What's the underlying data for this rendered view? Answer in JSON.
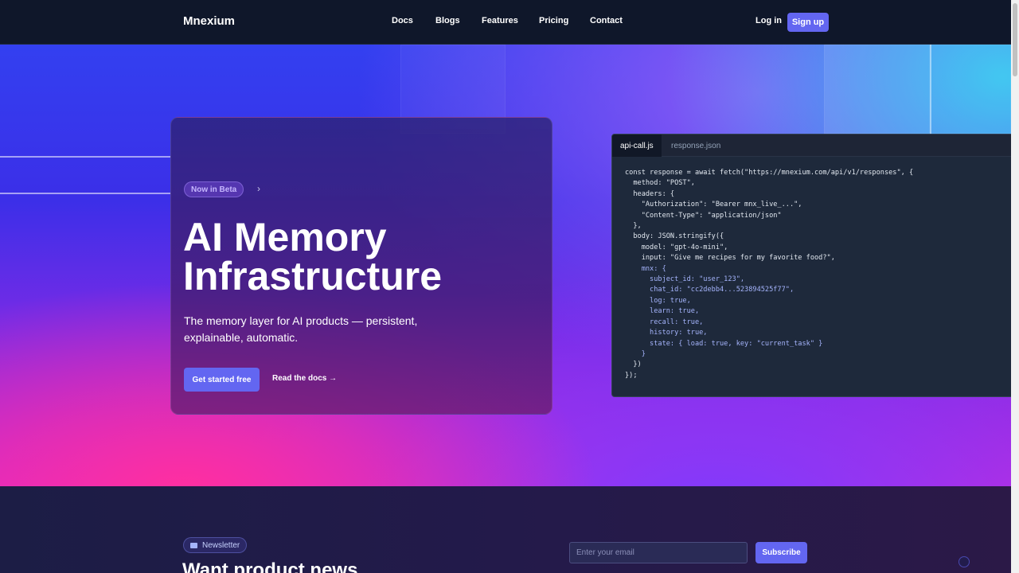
{
  "nav": {
    "brand": "Mnexium",
    "links": [
      "Docs",
      "Blogs",
      "Features",
      "Pricing",
      "Contact"
    ],
    "login": "Log in",
    "signup": "Sign up"
  },
  "hero": {
    "badge": "Now in Beta",
    "badge_arrow": "›",
    "title_line1": "AI Memory",
    "title_line2": "Infrastructure",
    "subtitle": "The memory layer for AI products — persistent, explainable, automatic.",
    "primary_cta": "Get started free",
    "secondary_cta": "Read the docs →"
  },
  "code_panel": {
    "tabs": [
      "api-call.js",
      "response.json"
    ],
    "active_tab": "api-call.js",
    "lines": [
      "const response = await fetch(\"https://mnexium.com/api/v1/responses\", {",
      "  method: \"POST\",",
      "  headers: {",
      "    \"Authorization\": \"Bearer mnx_live_...\",",
      "    \"Content-Type\": \"application/json\"",
      "  },",
      "  body: JSON.stringify({",
      "    model: \"gpt-4o-mini\",",
      "    input: \"Give me recipes for my favorite food?\",",
      "    mnx: {",
      "      subject_id: \"user_123\",",
      "      chat_id: \"cc2debb4...523894525f77\",",
      "      log: true,",
      "      learn: true,",
      "      recall: true,",
      "      history: true,",
      "      state: { load: true, key: \"current_task\" }",
      "    }",
      "  })",
      "});"
    ]
  },
  "newsletter": {
    "badge": "Newsletter",
    "heading": "Want product news",
    "email_placeholder": "Enter your email",
    "subscribe": "Subscribe"
  },
  "colors": {
    "accent": "#6366f1",
    "nav_bg": "#0f172a",
    "code_bg": "#1e293b"
  }
}
